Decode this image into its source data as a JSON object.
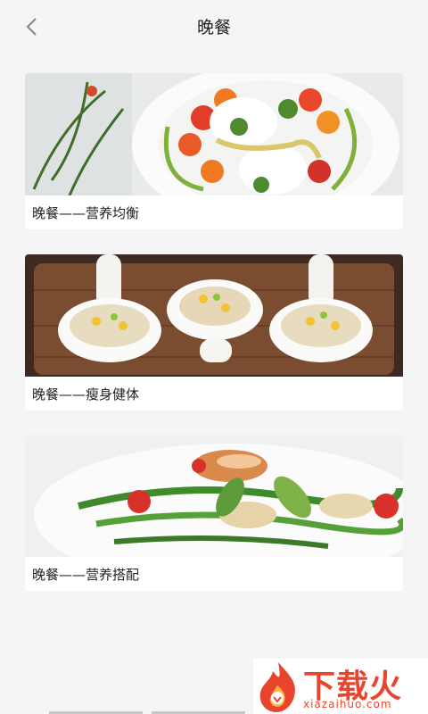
{
  "header": {
    "title": "晚餐"
  },
  "cards": [
    {
      "label": "晚餐——营养均衡"
    },
    {
      "label": "晚餐——瘦身健体"
    },
    {
      "label": "晚餐——营养搭配"
    }
  ],
  "watermark": {
    "brand": "下载火",
    "url": "xiazaihuo.com"
  },
  "colors": {
    "background": "#f5f5f5",
    "brand": "#e8452c"
  }
}
